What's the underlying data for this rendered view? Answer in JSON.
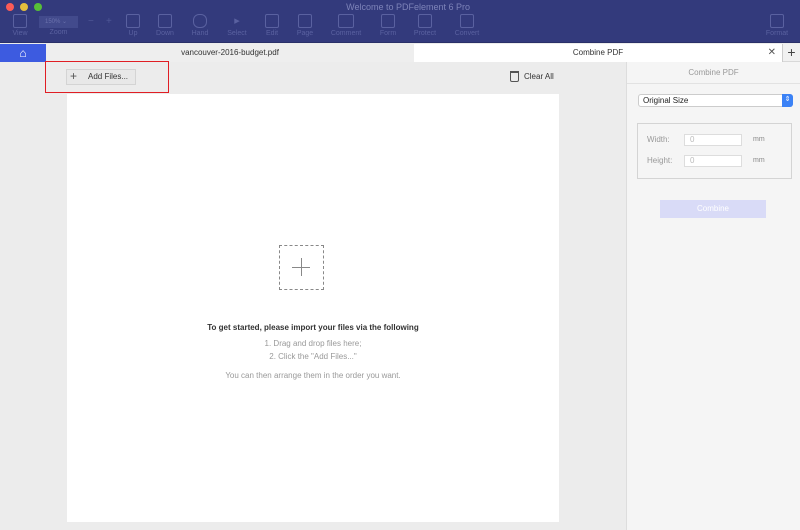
{
  "window": {
    "title": "Welcome to PDFelement 6 Pro"
  },
  "toolbar": {
    "zoom_value": "150%",
    "items": [
      "View",
      "Zoom",
      "Up",
      "Down",
      "Hand",
      "Select",
      "Edit",
      "Page",
      "Comment",
      "Form",
      "Protect",
      "Convert",
      "Format"
    ]
  },
  "tabs": [
    {
      "label": "vancouver-2016-budget.pdf"
    },
    {
      "label": "Combine PDF",
      "active": true
    }
  ],
  "actions": {
    "add_files": "Add Files...",
    "clear_all": "Clear All"
  },
  "empty_state": {
    "heading": "To get started, please import your files via the following",
    "step1": "1. Drag and drop files here;",
    "step2": "2. Click the \"Add Files...\"",
    "note": "You can then arrange them in the order you want."
  },
  "panel": {
    "title": "Combine PDF",
    "size_option": "Original Size",
    "width_label": "Width:",
    "width_value": "0",
    "height_label": "Height:",
    "height_value": "0",
    "unit": "mm",
    "combine_label": "Combine"
  },
  "colors": {
    "toolbar": "#333a7c",
    "home": "#3d5be0",
    "highlight": "#e01e24",
    "combine_disabled": "#d9dbf7"
  }
}
